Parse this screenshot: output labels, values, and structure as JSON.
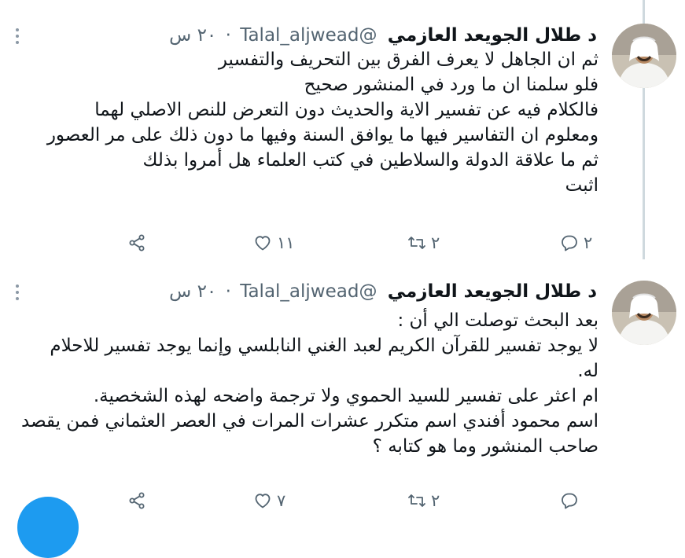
{
  "tweets": [
    {
      "author_name": "د طلال الجويعد العازمي",
      "handle": "@Talal_aljwead",
      "separator": "·",
      "time": "٢٠ س",
      "lines": [
        "ثم ان الجاهل لا يعرف الفرق بين التحريف والتفسير",
        "فلو سلمنا ان ما ورد في المنشور صحيح",
        "فالكلام فيه عن تفسير الاية والحديث دون التعرض للنص الاصلي لهما",
        "ومعلوم ان التفاسير فيها ما يوافق السنة وفيها ما دون ذلك على مر العصور",
        "ثم ما علاقة الدولة والسلاطين في كتب العلماء هل أمروا بذلك",
        "اثبت"
      ],
      "replies": "٢",
      "retweets": "٢",
      "likes": "١١"
    },
    {
      "author_name": "د طلال الجويعد العازمي",
      "handle": "@Talal_aljwead",
      "separator": "·",
      "time": "٢٠ س",
      "lines": [
        "بعد البحث توصلت الي أن :",
        "لا يوجد تفسير للقرآن الكريم لعبد الغني النابلسي وإنما يوجد تفسير للاحلام",
        "له.",
        "ام اعثر على تفسير للسيد الحموي ولا ترجمة واضحه لهذه الشخصية.",
        "اسم محمود أفندي اسم متكرر عشرات المرات في العصر العثماني فمن يقصد",
        "صاحب المنشور وما هو كتابه ؟"
      ],
      "replies": "",
      "retweets": "٢",
      "likes": "٧"
    }
  ],
  "colors": {
    "text": "#0f1419",
    "secondary": "#536471",
    "accent": "#1d9bf0",
    "thread_line": "#cfd9de"
  },
  "icons": {
    "reply": "reply-icon",
    "retweet": "retweet-icon",
    "like": "heart-icon",
    "share": "share-icon",
    "more": "more-vertical-icon"
  }
}
